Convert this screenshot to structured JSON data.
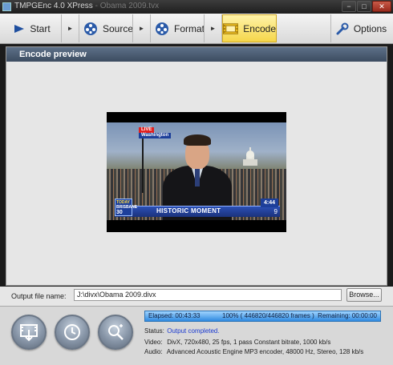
{
  "window": {
    "title": "TMPGEnc 4.0 XPress",
    "title_suffix": " - Obama 2009.tvx",
    "minimize_label": "−",
    "maximize_label": "□",
    "close_label": "✕"
  },
  "toolbar": {
    "start_label": "Start",
    "source_label": "Source",
    "format_label": "Format",
    "encode_label": "Encode",
    "options_label": "Options",
    "arrow": "►"
  },
  "main": {
    "section_title": "Encode preview"
  },
  "video": {
    "live": "LIVE",
    "location": "Washington",
    "channel_line1": "TODAY",
    "channel_line2": "BRISBANE",
    "channel_temp": "30",
    "headline": "HISTORIC MOMENT",
    "clock": "4:44",
    "network": "9"
  },
  "output": {
    "label": "Output file name:",
    "value": "J:\\divx\\Obama 2009.divx",
    "browse_label": "Browse..."
  },
  "progress": {
    "elapsed": "Elapsed: 00:43:33",
    "percent_text": "100% ( 446820/446820 frames )",
    "remaining": "Remaining: 00:00:00",
    "percent": 100
  },
  "status": {
    "status_key": "Status:",
    "status_value": "Output completed.",
    "video_key": "Video:",
    "video_value": "DivX, 720x480, 25 fps, 1 pass Constant bitrate, 1000 kb/s",
    "audio_key": "Audio:",
    "audio_value": "Advanced Acoustic Engine MP3 encoder, 48000  Hz, Stereo, 128 kb/s"
  },
  "colors": {
    "section_header": "#4a5b70",
    "active_tab": "#f5d64a",
    "progress_bar": "#3a9ce6",
    "status_ok": "#1a3ad0"
  }
}
